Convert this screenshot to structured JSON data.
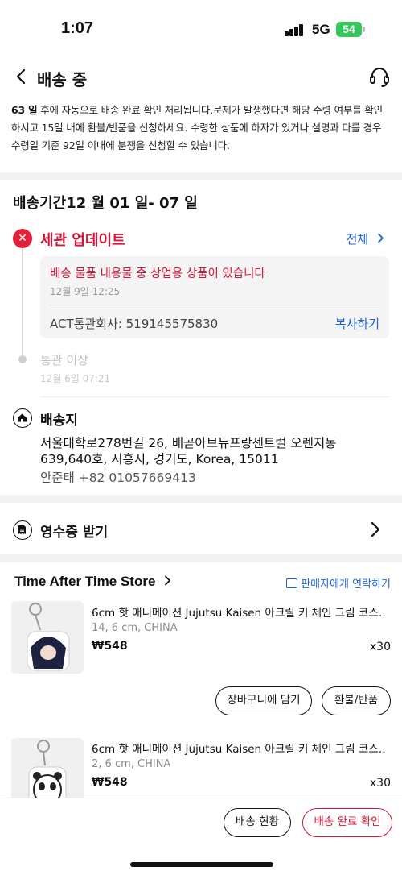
{
  "status_bar": {
    "time": "1:07",
    "network": "5G",
    "battery": "54"
  },
  "nav": {
    "title": "배송 중"
  },
  "notice": {
    "days": "63 일",
    "text": " 후에 자동으로 배송 완료 확인 처리됩니다.문제가 발생했다면 해당 수령 여부를 확인하시고 15일 내에 환불/반품을 신청하세요. 수령한 상품에 하자가 있거나 설명과 다를 경우 수령일 기준 92일 이내에 분쟁을 신청할 수 있습니다."
  },
  "delivery_period": "배송기간12 월 01 일- 07 일",
  "timeline": {
    "current": {
      "title": "세관 업데이트",
      "all_link": "전체",
      "message": "배송 물품 내용물 중 상업용 상품이 있습니다",
      "time": "12월 9일 12:25",
      "act": "ACT통관회사: 519145575830",
      "copy_label": "복사하기"
    },
    "past": {
      "title": "통관 이상",
      "time": "12월 6일 07:21"
    }
  },
  "destination": {
    "label": "배송지",
    "address": "서울대학로278번길 26, 배곧아브뉴프랑센트럴 오렌지동 639,640호, 시흥시, 경기도, Korea, 15011",
    "recipient": "안준태 +82 01057669413"
  },
  "receipt": {
    "label": "영수증 받기"
  },
  "store": {
    "name": "Time After Time Store",
    "contact_label": "판매자에게 연락하기",
    "items": [
      {
        "name": "6cm 핫 애니메이션 Jujutsu Kaisen   아크릴 키 체인 그림 코스…",
        "spec": "14, 6 cm, CHINA",
        "price": "₩548",
        "qty": "x30",
        "cart_label": "장바구니에 담기",
        "refund_label": "환불/반품"
      },
      {
        "name": "6cm 핫 애니메이션 Jujutsu Kaisen   아크릴 키 체인 그림 코스…",
        "spec": "2, 6 cm, CHINA",
        "price": "₩548",
        "qty": "x30"
      }
    ]
  },
  "bottom": {
    "track_label": "배송 현황",
    "confirm_label": "배송 완료 확인"
  },
  "colors": {
    "accent_red": "#d0183a",
    "link_blue": "#1e63d6",
    "battery_green": "#35c759"
  },
  "icons": [
    "back-icon",
    "headset-icon",
    "close-icon",
    "chevron-right-icon",
    "home-icon",
    "receipt-icon",
    "chat-icon"
  ]
}
